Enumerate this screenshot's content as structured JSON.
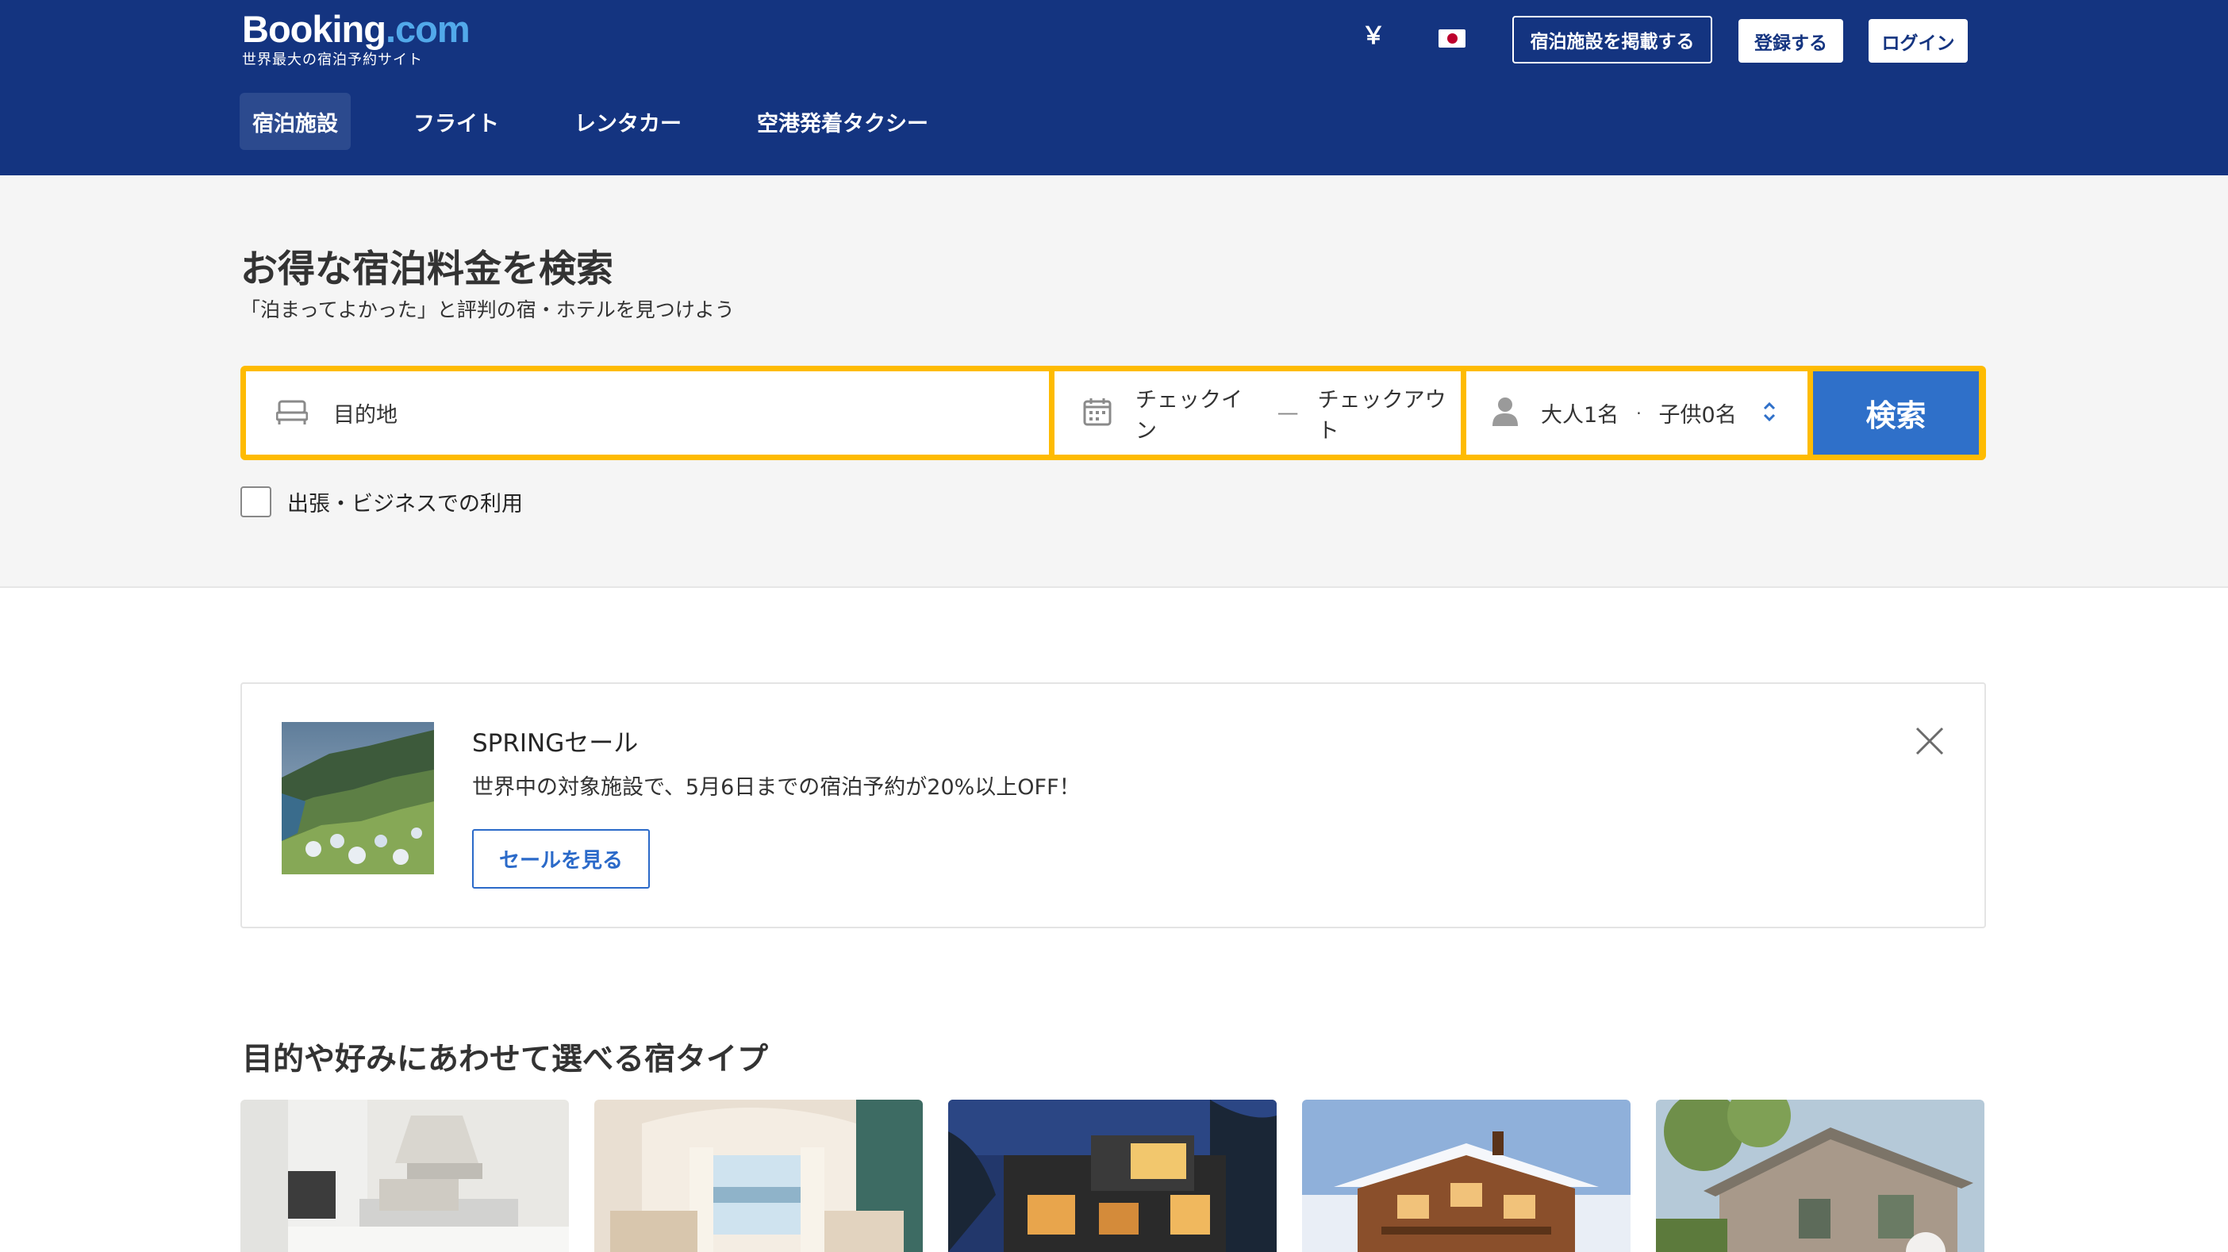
{
  "header": {
    "logo_word": "Booking",
    "logo_dotcom": ".com",
    "logo_tagline": "世界最大の宿泊予約サイト",
    "currency_symbol": "￥",
    "language_flag": "japan-flag",
    "list_property_label": "宿泊施設を掲載する",
    "register_label": "登録する",
    "login_label": "ログイン",
    "colors": {
      "background": "#143480",
      "accent_blue": "#52a9ea"
    }
  },
  "nav": {
    "tabs": [
      {
        "label": "宿泊施設",
        "active": true
      },
      {
        "label": "フライト",
        "active": false
      },
      {
        "label": "レンタカー",
        "active": false
      },
      {
        "label": "空港発着タクシー",
        "active": false
      }
    ]
  },
  "hero": {
    "title": "お得な宿泊料金を検索",
    "subtitle": "「泊まってよかった」と評判の宿・ホテルを見つけよう"
  },
  "search": {
    "destination_placeholder": "目的地",
    "checkin_label": "チェックイン",
    "date_separator": "—",
    "checkout_label": "チェックアウト",
    "adults_label": "大人1名",
    "guest_separator": "·",
    "children_label": "子供0名",
    "search_button": "検索",
    "business_checkbox_label": "出張・ビジネスでの利用",
    "business_checked": false,
    "colors": {
      "border": "#febb02",
      "button": "#2f70c9"
    }
  },
  "promo": {
    "title": "SPRINGセール",
    "text": "世界中の対象施設で、5月6日までの宿泊予約が20%以上OFF！",
    "button_label": "セールを見る"
  },
  "property_types": {
    "title": "目的や好みにあわせて選べる宿タイプ",
    "cards": [
      "apartment-photo",
      "resort-room-photo",
      "villa-night-photo",
      "chalet-snow-photo",
      "cottage-stone-photo"
    ]
  }
}
